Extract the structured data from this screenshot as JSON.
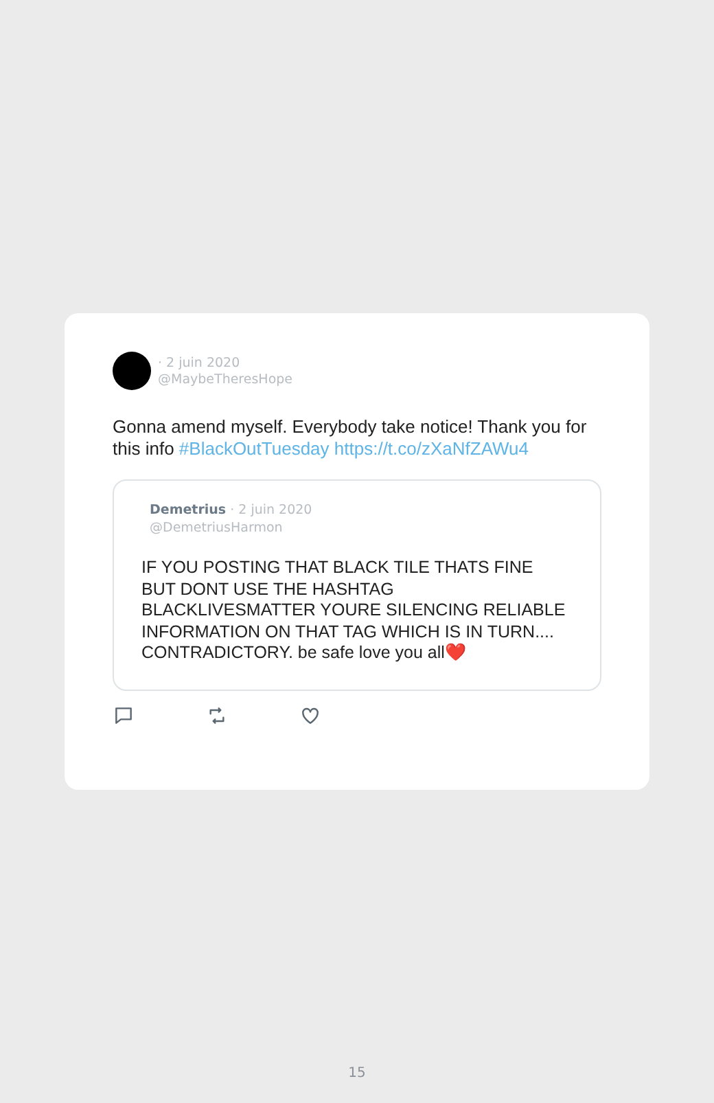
{
  "tweet": {
    "date": "· 2 juin 2020",
    "handle": "@MaybeTheresHope",
    "text_parts": [
      {
        "kind": "plain",
        "text": "Gonna amend myself. Everybody take notice! Thank you for this info "
      },
      {
        "kind": "link",
        "text": "#BlackOutTuesday"
      },
      {
        "kind": "link",
        "text": "https://t.co/zXaNfZAWu4"
      }
    ],
    "quote": {
      "name": "Demetrius",
      "date": "· 2 juin 2020",
      "handle": "@DemetriusHarmon",
      "text": "IF YOU POSTING THAT BLACK TILE THATS FINE BUT DONT USE THE HASHTAG BLACKLIVESMATTER YOURE SILENCING RELIABLE INFORMATION ON THAT TAG WHICH IS IN TURN.... CONTRADICTORY. be safe love you all❤️"
    },
    "actions": [
      {
        "kind": "reply"
      },
      {
        "kind": "retweet"
      },
      {
        "kind": "like"
      }
    ]
  },
  "page_number": "15"
}
